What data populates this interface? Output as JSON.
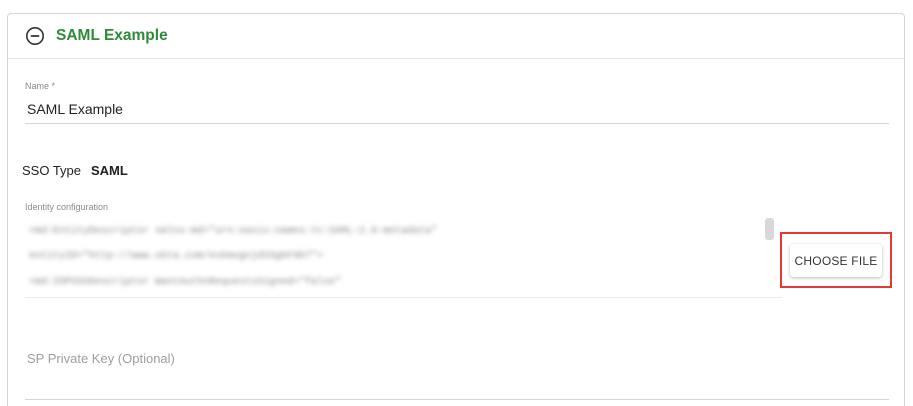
{
  "card": {
    "title": "SAML Example"
  },
  "name_field": {
    "label": "Name *",
    "value": "SAML Example"
  },
  "sso": {
    "label": "SSO Type",
    "value": "SAML"
  },
  "identity_config": {
    "label": "Identity configuration",
    "lines": [
      "<md:EntityDescriptor xmlns:md=\"urn:oasis:names:tc:SAML:2.0:metadata\"",
      "entityID=\"http://www.okta.com/exkmognjd33gbF9b7\">",
      "<md:IDPSSODescriptor WantAuthnRequestsSigned=\"false\""
    ],
    "button_label": "CHOOSE FILE"
  },
  "sp_private_key": {
    "placeholder": "SP Private Key (Optional)"
  },
  "colors": {
    "title_green": "#2e8b3a",
    "highlight_red": "#e53935"
  }
}
